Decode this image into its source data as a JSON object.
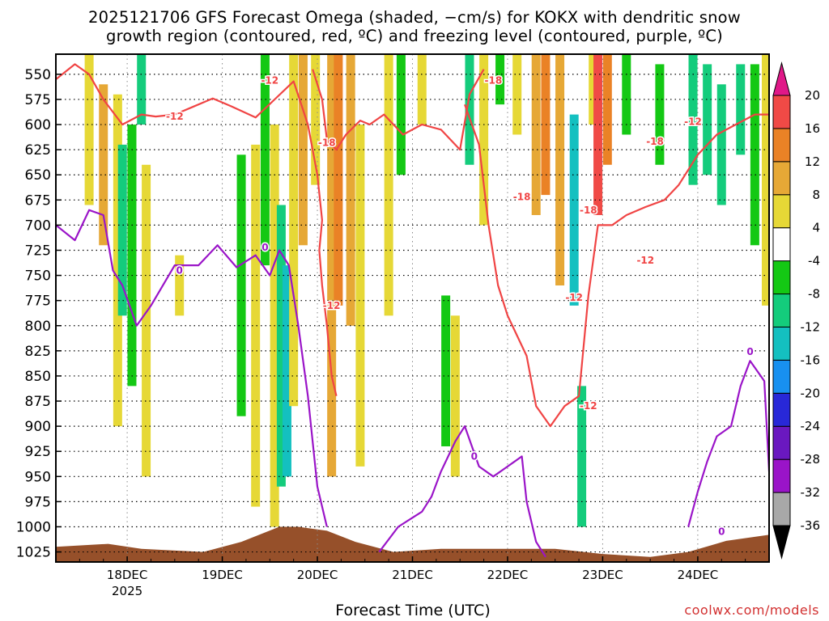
{
  "title": {
    "line1": "2025121706 GFS Forecast Omega (shaded, −cm/s) for KOKX with dendritic snow",
    "line2": "growth region (contoured, red, ºC) and freezing level (contoured, purple, ºC)"
  },
  "x_axis_title": "Forecast Time (UTC)",
  "credit": "coolwx.com/models",
  "chart_data": {
    "type": "heatmap",
    "title": "2025121706 GFS Forecast Omega (shaded, −cm/s) for KOKX with dendritic snow growth region (contoured, red, ºC) and freezing level (contoured, purple, ºC)",
    "xlabel": "Forecast Time (UTC)",
    "ylabel": "",
    "y_ticks": [
      550,
      575,
      600,
      625,
      650,
      675,
      700,
      725,
      750,
      775,
      800,
      825,
      850,
      875,
      900,
      925,
      950,
      975,
      1000,
      1025
    ],
    "ylim": [
      1035,
      530
    ],
    "x_ticks": [
      {
        "label": "18DEC",
        "sublabel": "2025",
        "day": 18
      },
      {
        "label": "19DEC",
        "sublabel": "",
        "day": 19
      },
      {
        "label": "20DEC",
        "sublabel": "",
        "day": 20
      },
      {
        "label": "21DEC",
        "sublabel": "",
        "day": 21
      },
      {
        "label": "22DEC",
        "sublabel": "",
        "day": 22
      },
      {
        "label": "23DEC",
        "sublabel": "",
        "day": 23
      },
      {
        "label": "24DEC",
        "sublabel": "",
        "day": 24
      }
    ],
    "xlim_days": [
      17.25,
      24.75
    ],
    "grid": true,
    "colorbar": {
      "levels": [
        -36,
        -32,
        -28,
        -24,
        -20,
        -16,
        -12,
        -8,
        -4,
        4,
        8,
        12,
        16,
        20
      ],
      "colors": [
        "#a8a8a8",
        "#9a14c8",
        "#6a18c0",
        "#2828d8",
        "#1890f0",
        "#14c0c0",
        "#14cc7c",
        "#14c814",
        "#ffffff",
        "#e6d836",
        "#e6a836",
        "#ea8226",
        "#f04a46",
        "#e01888"
      ],
      "under_color": "#000000",
      "over_color": "#e01888"
    },
    "omega_bands": [
      {
        "day": 17.6,
        "p_top": 530,
        "p_bot": 680,
        "value": 6
      },
      {
        "day": 17.75,
        "p_top": 560,
        "p_bot": 720,
        "value": 10
      },
      {
        "day": 17.9,
        "p_top": 570,
        "p_bot": 900,
        "value": 5
      },
      {
        "day": 17.95,
        "p_top": 620,
        "p_bot": 790,
        "value": -9
      },
      {
        "day": 18.05,
        "p_top": 600,
        "p_bot": 860,
        "value": -7
      },
      {
        "day": 18.15,
        "p_top": 530,
        "p_bot": 600,
        "value": -10
      },
      {
        "day": 18.2,
        "p_top": 640,
        "p_bot": 950,
        "value": 5
      },
      {
        "day": 18.55,
        "p_top": 730,
        "p_bot": 790,
        "value": 5
      },
      {
        "day": 19.2,
        "p_top": 630,
        "p_bot": 890,
        "value": -7
      },
      {
        "day": 19.35,
        "p_top": 620,
        "p_bot": 980,
        "value": 6
      },
      {
        "day": 19.45,
        "p_top": 530,
        "p_bot": 740,
        "value": -8
      },
      {
        "day": 19.55,
        "p_top": 600,
        "p_bot": 1000,
        "value": 7
      },
      {
        "day": 19.62,
        "p_top": 680,
        "p_bot": 960,
        "value": -10
      },
      {
        "day": 19.68,
        "p_top": 740,
        "p_bot": 950,
        "value": -16
      },
      {
        "day": 19.75,
        "p_top": 530,
        "p_bot": 880,
        "value": 5
      },
      {
        "day": 19.85,
        "p_top": 530,
        "p_bot": 720,
        "value": 9
      },
      {
        "day": 19.98,
        "p_top": 530,
        "p_bot": 660,
        "value": 6
      },
      {
        "day": 20.15,
        "p_top": 530,
        "p_bot": 950,
        "value": 9
      },
      {
        "day": 20.22,
        "p_top": 530,
        "p_bot": 780,
        "value": 13
      },
      {
        "day": 20.35,
        "p_top": 530,
        "p_bot": 800,
        "value": 8
      },
      {
        "day": 20.45,
        "p_top": 600,
        "p_bot": 940,
        "value": 6
      },
      {
        "day": 20.75,
        "p_top": 530,
        "p_bot": 790,
        "value": 5
      },
      {
        "day": 20.88,
        "p_top": 530,
        "p_bot": 650,
        "value": -8
      },
      {
        "day": 21.1,
        "p_top": 530,
        "p_bot": 600,
        "value": 5
      },
      {
        "day": 21.35,
        "p_top": 770,
        "p_bot": 920,
        "value": -7
      },
      {
        "day": 21.45,
        "p_top": 790,
        "p_bot": 950,
        "value": 6
      },
      {
        "day": 21.6,
        "p_top": 530,
        "p_bot": 640,
        "value": -9
      },
      {
        "day": 21.75,
        "p_top": 530,
        "p_bot": 700,
        "value": 6
      },
      {
        "day": 21.92,
        "p_top": 530,
        "p_bot": 580,
        "value": -7
      },
      {
        "day": 22.1,
        "p_top": 530,
        "p_bot": 610,
        "value": 5
      },
      {
        "day": 22.3,
        "p_top": 530,
        "p_bot": 690,
        "value": 10
      },
      {
        "day": 22.4,
        "p_top": 530,
        "p_bot": 670,
        "value": 13
      },
      {
        "day": 22.55,
        "p_top": 530,
        "p_bot": 760,
        "value": 9
      },
      {
        "day": 22.7,
        "p_top": 590,
        "p_bot": 780,
        "value": -14
      },
      {
        "day": 22.78,
        "p_top": 860,
        "p_bot": 1000,
        "value": -12
      },
      {
        "day": 22.9,
        "p_top": 530,
        "p_bot": 600,
        "value": 6
      },
      {
        "day": 22.95,
        "p_top": 530,
        "p_bot": 690,
        "value": 17
      },
      {
        "day": 23.05,
        "p_top": 530,
        "p_bot": 640,
        "value": 12
      },
      {
        "day": 23.25,
        "p_top": 530,
        "p_bot": 610,
        "value": -8
      },
      {
        "day": 23.6,
        "p_top": 540,
        "p_bot": 640,
        "value": -8
      },
      {
        "day": 23.95,
        "p_top": 530,
        "p_bot": 660,
        "value": -9
      },
      {
        "day": 24.1,
        "p_top": 540,
        "p_bot": 650,
        "value": -12
      },
      {
        "day": 24.25,
        "p_top": 560,
        "p_bot": 680,
        "value": -10
      },
      {
        "day": 24.45,
        "p_top": 540,
        "p_bot": 630,
        "value": -12
      },
      {
        "day": 24.6,
        "p_top": 540,
        "p_bot": 720,
        "value": -7
      },
      {
        "day": 24.72,
        "p_top": 530,
        "p_bot": 780,
        "value": 7
      }
    ],
    "series": [
      {
        "name": "dendritic snow growth region -12°C (left)",
        "color": "#f04444",
        "points": [
          [
            17.25,
            555
          ],
          [
            17.45,
            540
          ],
          [
            17.6,
            550
          ],
          [
            17.75,
            575
          ],
          [
            17.95,
            600
          ],
          [
            18.15,
            590
          ],
          [
            18.3,
            592
          ],
          [
            18.5,
            590
          ],
          [
            18.7,
            582
          ],
          [
            18.9,
            574
          ],
          [
            19.1,
            582
          ],
          [
            19.35,
            593
          ],
          [
            19.55,
            575
          ],
          [
            19.75,
            557
          ],
          [
            19.9,
            600
          ],
          [
            20.0,
            650
          ],
          [
            20.05,
            695
          ],
          [
            20.02,
            725
          ],
          [
            20.05,
            760
          ],
          [
            20.1,
            800
          ],
          [
            20.15,
            850
          ],
          [
            20.2,
            870
          ]
        ]
      },
      {
        "name": "dendritic snow growth region -18°C",
        "color": "#f04444",
        "points": [
          [
            19.95,
            545
          ],
          [
            20.05,
            575
          ],
          [
            20.1,
            615
          ],
          [
            20.2,
            625
          ],
          [
            20.3,
            610
          ],
          [
            20.45,
            596
          ],
          [
            20.55,
            600
          ],
          [
            20.7,
            590
          ],
          [
            20.9,
            610
          ],
          [
            21.1,
            600
          ],
          [
            21.3,
            605
          ],
          [
            21.5,
            625
          ],
          [
            21.6,
            570
          ],
          [
            21.75,
            545
          ]
        ]
      },
      {
        "name": "dendritic snow growth region -12°C (right)",
        "color": "#f04444",
        "points": [
          [
            21.55,
            580
          ],
          [
            21.7,
            620
          ],
          [
            21.8,
            700
          ],
          [
            21.9,
            760
          ],
          [
            22.0,
            790
          ],
          [
            22.2,
            830
          ],
          [
            22.3,
            880
          ],
          [
            22.45,
            900
          ],
          [
            22.6,
            880
          ],
          [
            22.75,
            870
          ],
          [
            22.85,
            770
          ],
          [
            22.95,
            700
          ],
          [
            23.1,
            700
          ],
          [
            23.25,
            690
          ],
          [
            23.45,
            682
          ],
          [
            23.65,
            675
          ],
          [
            23.8,
            660
          ],
          [
            24.0,
            630
          ],
          [
            24.2,
            610
          ],
          [
            24.4,
            600
          ],
          [
            24.6,
            590
          ],
          [
            24.75,
            590
          ]
        ]
      },
      {
        "name": "freezing level 0°C (left)",
        "color": "#9a14c8",
        "points": [
          [
            17.25,
            700
          ],
          [
            17.45,
            715
          ],
          [
            17.6,
            685
          ],
          [
            17.75,
            690
          ],
          [
            17.85,
            745
          ],
          [
            17.95,
            760
          ],
          [
            18.1,
            800
          ],
          [
            18.25,
            780
          ],
          [
            18.5,
            740
          ],
          [
            18.75,
            740
          ],
          [
            18.95,
            720
          ],
          [
            19.15,
            742
          ],
          [
            19.35,
            730
          ],
          [
            19.5,
            750
          ],
          [
            19.6,
            725
          ],
          [
            19.7,
            740
          ],
          [
            19.8,
            800
          ],
          [
            19.9,
            870
          ],
          [
            20.0,
            960
          ],
          [
            20.1,
            1000
          ]
        ]
      },
      {
        "name": "freezing level 0°C (mid)",
        "color": "#9a14c8",
        "points": [
          [
            20.65,
            1025
          ],
          [
            20.85,
            1000
          ],
          [
            21.1,
            985
          ],
          [
            21.2,
            970
          ],
          [
            21.3,
            945
          ],
          [
            21.45,
            915
          ],
          [
            21.55,
            900
          ],
          [
            21.7,
            940
          ],
          [
            21.85,
            950
          ],
          [
            22.0,
            940
          ],
          [
            22.15,
            930
          ],
          [
            22.2,
            975
          ],
          [
            22.3,
            1015
          ],
          [
            22.4,
            1030
          ]
        ]
      },
      {
        "name": "freezing level 0°C (right)",
        "color": "#9a14c8",
        "points": [
          [
            23.9,
            1000
          ],
          [
            24.0,
            965
          ],
          [
            24.1,
            935
          ],
          [
            24.2,
            910
          ],
          [
            24.35,
            900
          ],
          [
            24.45,
            860
          ],
          [
            24.55,
            835
          ],
          [
            24.7,
            855
          ],
          [
            24.75,
            945
          ]
        ]
      }
    ],
    "contour_labels": [
      {
        "text": "-12",
        "day": 18.5,
        "p": 592,
        "color": "#f04444"
      },
      {
        "text": "-12",
        "day": 19.5,
        "p": 556,
        "color": "#f04444"
      },
      {
        "text": "-18",
        "day": 20.1,
        "p": 618,
        "color": "#f04444"
      },
      {
        "text": "-12",
        "day": 20.15,
        "p": 780,
        "color": "#f04444"
      },
      {
        "text": "-18",
        "day": 21.85,
        "p": 556,
        "color": "#f04444"
      },
      {
        "text": "-18",
        "day": 22.15,
        "p": 672,
        "color": "#f04444"
      },
      {
        "text": "-18",
        "day": 22.85,
        "p": 685,
        "color": "#f04444"
      },
      {
        "text": "-12",
        "day": 22.7,
        "p": 772,
        "color": "#f04444"
      },
      {
        "text": "-12",
        "day": 22.85,
        "p": 880,
        "color": "#f04444"
      },
      {
        "text": "-12",
        "day": 23.45,
        "p": 735,
        "color": "#f04444"
      },
      {
        "text": "-18",
        "day": 23.55,
        "p": 617,
        "color": "#f04444"
      },
      {
        "text": "-12",
        "day": 23.95,
        "p": 597,
        "color": "#f04444"
      },
      {
        "text": "0",
        "day": 19.45,
        "p": 722,
        "color": "#9a14c8"
      },
      {
        "text": "0",
        "day": 18.55,
        "p": 745,
        "color": "#9a14c8"
      },
      {
        "text": "0",
        "day": 24.55,
        "p": 826,
        "color": "#9a14c8"
      },
      {
        "text": "0",
        "day": 21.65,
        "p": 930,
        "color": "#9a14c8"
      },
      {
        "text": "0",
        "day": 24.25,
        "p": 1005,
        "color": "#9a14c8"
      }
    ],
    "terrain": [
      [
        17.25,
        1020
      ],
      [
        17.8,
        1017
      ],
      [
        18.15,
        1022
      ],
      [
        18.8,
        1025
      ],
      [
        19.2,
        1015
      ],
      [
        19.6,
        1000
      ],
      [
        19.8,
        1000
      ],
      [
        20.1,
        1004
      ],
      [
        20.4,
        1015
      ],
      [
        20.8,
        1025
      ],
      [
        21.3,
        1022
      ],
      [
        21.9,
        1022
      ],
      [
        22.5,
        1022
      ],
      [
        23.0,
        1027
      ],
      [
        23.5,
        1030
      ],
      [
        23.9,
        1025
      ],
      [
        24.3,
        1014
      ],
      [
        24.75,
        1008
      ]
    ]
  }
}
